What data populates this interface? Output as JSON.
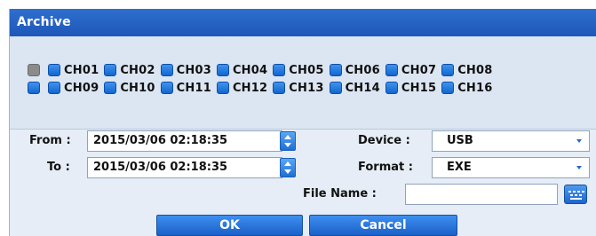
{
  "dialog": {
    "title": "Archive"
  },
  "channels": {
    "row1": [
      "CH01",
      "CH02",
      "CH03",
      "CH04",
      "CH05",
      "CH06",
      "CH07",
      "CH08"
    ],
    "row2": [
      "CH09",
      "CH10",
      "CH11",
      "CH12",
      "CH13",
      "CH14",
      "CH15",
      "CH16"
    ]
  },
  "form": {
    "from_label": "From :",
    "from_value": "2015/03/06 02:18:35",
    "to_label": "To :",
    "to_value": "2015/03/06 02:18:35",
    "device_label": "Device :",
    "device_value": "USB",
    "format_label": "Format :",
    "format_value": "EXE",
    "filename_label": "File Name :",
    "filename_value": ""
  },
  "buttons": {
    "ok": "OK",
    "cancel": "Cancel"
  },
  "colors": {
    "titlebar": "#1d57b8",
    "accent": "#1a60c9",
    "panel": "#dce6f2",
    "background": "#e6edf6"
  },
  "icons": {
    "select_all": "select-all-square-icon",
    "channel_checkbox": "channel-checkbox-icon",
    "spinner": "spinner-arrows-icon",
    "dropdown": "chevron-down-icon",
    "keyboard": "keyboard-icon"
  }
}
